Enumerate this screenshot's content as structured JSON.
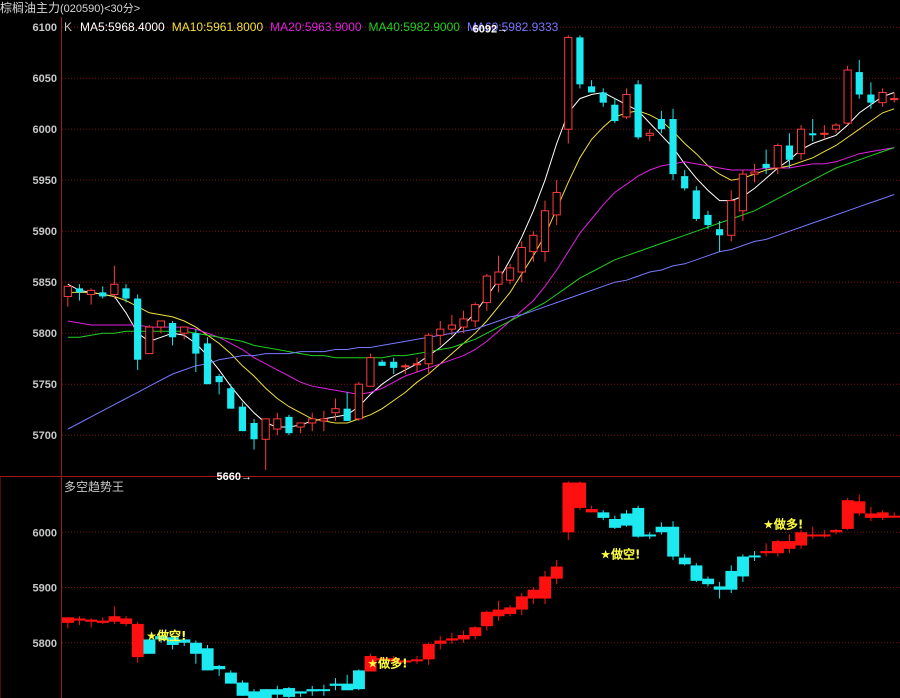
{
  "header": {
    "instrument": "棕榈油主力",
    "code": "(020590)",
    "period": "<30分>"
  },
  "colors": {
    "up": "#ff3b3b",
    "down": "#1de9f0",
    "grid": "#7a1010",
    "frame": "#a01818",
    "ma5": "#ffffff",
    "ma10": "#f0e040",
    "ma20": "#e020e0",
    "ma40": "#20d020",
    "ma60": "#7878ff",
    "signal_up_bar": "#ff1010",
    "signal_down_bar": "#1de9f0",
    "signal_text": "#ffff40"
  },
  "legend": {
    "k_label": "K",
    "items": [
      {
        "key": "ma5",
        "text": "MA5:5968.4000"
      },
      {
        "key": "ma10",
        "text": "MA10:5961.8000"
      },
      {
        "key": "ma20",
        "text": "MA20:5963.9000"
      },
      {
        "key": "ma40",
        "text": "MA40:5982.9000"
      },
      {
        "key": "ma60",
        "text": "MA60:5982.9333"
      }
    ]
  },
  "lower_panel": {
    "title": "多空趋势王"
  },
  "chart_data": [
    {
      "type": "candlestick",
      "panel": "upper",
      "title": "K",
      "ylim": [
        5660,
        6110
      ],
      "y_ticks": [
        5700,
        5750,
        5800,
        5850,
        5900,
        5950,
        6000,
        6050,
        6100
      ],
      "annotations": [
        {
          "text": "6092→",
          "bar_index": 38,
          "value": 6092
        },
        {
          "text": "5660→",
          "bar_index": 16,
          "value": 5660
        }
      ],
      "ohlc": [
        [
          5836,
          5846,
          5826,
          5846
        ],
        [
          5844,
          5848,
          5832,
          5840
        ],
        [
          5838,
          5844,
          5828,
          5842
        ],
        [
          5840,
          5846,
          5834,
          5836
        ],
        [
          5838,
          5866,
          5834,
          5848
        ],
        [
          5844,
          5848,
          5830,
          5834
        ],
        [
          5834,
          5838,
          5764,
          5774
        ],
        [
          5780,
          5808,
          5780,
          5806
        ],
        [
          5806,
          5812,
          5800,
          5812
        ],
        [
          5810,
          5812,
          5788,
          5796
        ],
        [
          5800,
          5806,
          5794,
          5806
        ],
        [
          5800,
          5804,
          5762,
          5780
        ],
        [
          5790,
          5796,
          5750,
          5750
        ],
        [
          5758,
          5760,
          5740,
          5752
        ],
        [
          5746,
          5750,
          5726,
          5726
        ],
        [
          5728,
          5732,
          5704,
          5704
        ],
        [
          5712,
          5716,
          5686,
          5696
        ],
        [
          5696,
          5716,
          5666,
          5716
        ],
        [
          5706,
          5722,
          5700,
          5716
        ],
        [
          5718,
          5720,
          5700,
          5702
        ],
        [
          5708,
          5712,
          5702,
          5712
        ],
        [
          5712,
          5722,
          5704,
          5716
        ],
        [
          5714,
          5724,
          5704,
          5716
        ],
        [
          5722,
          5736,
          5714,
          5726
        ],
        [
          5726,
          5742,
          5714,
          5714
        ],
        [
          5716,
          5752,
          5714,
          5750
        ],
        [
          5748,
          5780,
          5748,
          5776
        ],
        [
          5772,
          5774,
          5768,
          5768
        ],
        [
          5772,
          5776,
          5760,
          5766
        ],
        [
          5768,
          5770,
          5760,
          5768
        ],
        [
          5770,
          5776,
          5762,
          5770
        ],
        [
          5770,
          5800,
          5760,
          5798
        ],
        [
          5798,
          5812,
          5788,
          5804
        ],
        [
          5804,
          5818,
          5798,
          5808
        ],
        [
          5806,
          5822,
          5800,
          5814
        ],
        [
          5812,
          5830,
          5806,
          5828
        ],
        [
          5830,
          5858,
          5822,
          5856
        ],
        [
          5848,
          5876,
          5840,
          5860
        ],
        [
          5852,
          5868,
          5848,
          5864
        ],
        [
          5860,
          5890,
          5850,
          5884
        ],
        [
          5880,
          5900,
          5870,
          5896
        ],
        [
          5880,
          5930,
          5870,
          5920
        ],
        [
          5916,
          5950,
          5906,
          5938
        ],
        [
          6000,
          6092,
          5986,
          6090
        ],
        [
          6090,
          6092,
          6040,
          6044
        ],
        [
          6042,
          6048,
          6036,
          6036
        ],
        [
          6036,
          6040,
          6022,
          6026
        ],
        [
          6024,
          6030,
          6006,
          6008
        ],
        [
          6012,
          6040,
          6010,
          6034
        ],
        [
          6044,
          6048,
          5990,
          5992
        ],
        [
          5994,
          6000,
          5988,
          5996
        ],
        [
          6010,
          6018,
          5996,
          6000
        ],
        [
          6010,
          6020,
          5950,
          5956
        ],
        [
          5954,
          5960,
          5940,
          5942
        ],
        [
          5940,
          5944,
          5910,
          5912
        ],
        [
          5916,
          5920,
          5902,
          5906
        ],
        [
          5902,
          5910,
          5880,
          5896
        ],
        [
          5896,
          5940,
          5890,
          5930
        ],
        [
          5920,
          5960,
          5910,
          5956
        ],
        [
          5956,
          5966,
          5948,
          5958
        ],
        [
          5966,
          5980,
          5956,
          5962
        ],
        [
          5962,
          5986,
          5956,
          5984
        ],
        [
          5984,
          5996,
          5962,
          5970
        ],
        [
          5976,
          6004,
          5970,
          6000
        ],
        [
          5996,
          6010,
          5988,
          5994
        ],
        [
          5996,
          6004,
          5990,
          5996
        ],
        [
          6000,
          6006,
          5996,
          6004
        ],
        [
          6006,
          6062,
          6004,
          6058
        ],
        [
          6056,
          6068,
          6030,
          6034
        ],
        [
          6034,
          6046,
          6020,
          6026
        ],
        [
          6026,
          6040,
          6022,
          6036
        ],
        [
          6030,
          6036,
          6026,
          6030
        ]
      ],
      "series": [
        {
          "name": "MA5",
          "values": [
            5848,
            5842,
            5840,
            5838,
            5836,
            5820,
            5800,
            5792,
            5796,
            5800,
            5798,
            5790,
            5778,
            5764,
            5748,
            5734,
            5722,
            5712,
            5708,
            5708,
            5710,
            5714,
            5716,
            5718,
            5720,
            5728,
            5740,
            5750,
            5758,
            5764,
            5770,
            5778,
            5786,
            5796,
            5808,
            5820,
            5836,
            5852,
            5872,
            5894,
            5920,
            5950,
            5986,
            6016,
            6030,
            6034,
            6036,
            6030,
            6024,
            6018,
            6006,
            5994,
            5982,
            5966,
            5952,
            5940,
            5930,
            5930,
            5934,
            5942,
            5952,
            5962,
            5970,
            5980,
            5986,
            5990,
            5994,
            6004,
            6016,
            6024,
            6032,
            6036
          ]
        },
        {
          "name": "MA10",
          "values": [
            5840,
            5840,
            5840,
            5838,
            5836,
            5832,
            5826,
            5820,
            5818,
            5816,
            5812,
            5806,
            5798,
            5790,
            5780,
            5768,
            5758,
            5746,
            5736,
            5728,
            5722,
            5716,
            5714,
            5712,
            5712,
            5716,
            5720,
            5726,
            5734,
            5742,
            5752,
            5760,
            5770,
            5780,
            5790,
            5800,
            5812,
            5826,
            5840,
            5858,
            5876,
            5896,
            5922,
            5948,
            5972,
            5990,
            6002,
            6012,
            6016,
            6018,
            6014,
            6008,
            5998,
            5986,
            5976,
            5964,
            5956,
            5950,
            5952,
            5956,
            5960,
            5962,
            5964,
            5968,
            5972,
            5978,
            5984,
            5992,
            6000,
            6008,
            6016,
            6020
          ]
        },
        {
          "name": "MA20",
          "values": [
            5812,
            5810,
            5808,
            5808,
            5808,
            5808,
            5808,
            5806,
            5806,
            5806,
            5806,
            5804,
            5800,
            5796,
            5790,
            5784,
            5776,
            5770,
            5764,
            5758,
            5752,
            5748,
            5746,
            5744,
            5742,
            5740,
            5742,
            5746,
            5752,
            5758,
            5762,
            5766,
            5770,
            5774,
            5778,
            5784,
            5792,
            5802,
            5812,
            5822,
            5832,
            5846,
            5862,
            5880,
            5898,
            5912,
            5926,
            5938,
            5946,
            5954,
            5960,
            5964,
            5966,
            5968,
            5966,
            5964,
            5962,
            5960,
            5960,
            5960,
            5962,
            5962,
            5962,
            5964,
            5966,
            5966,
            5968,
            5972,
            5976,
            5978,
            5980,
            5982
          ]
        },
        {
          "name": "MA40",
          "values": [
            5796,
            5796,
            5798,
            5800,
            5800,
            5802,
            5802,
            5802,
            5802,
            5802,
            5802,
            5800,
            5798,
            5796,
            5794,
            5792,
            5788,
            5786,
            5784,
            5782,
            5780,
            5778,
            5778,
            5776,
            5776,
            5776,
            5776,
            5776,
            5778,
            5778,
            5780,
            5782,
            5784,
            5786,
            5790,
            5794,
            5800,
            5806,
            5812,
            5818,
            5824,
            5830,
            5838,
            5846,
            5854,
            5860,
            5866,
            5872,
            5876,
            5880,
            5884,
            5888,
            5892,
            5896,
            5900,
            5904,
            5908,
            5912,
            5916,
            5920,
            5926,
            5932,
            5938,
            5944,
            5950,
            5956,
            5962,
            5966,
            5970,
            5974,
            5978,
            5982
          ]
        },
        {
          "name": "MA60",
          "values": [
            5706,
            5712,
            5718,
            5724,
            5730,
            5736,
            5742,
            5748,
            5754,
            5760,
            5764,
            5768,
            5770,
            5774,
            5776,
            5778,
            5778,
            5780,
            5780,
            5780,
            5782,
            5782,
            5782,
            5784,
            5784,
            5786,
            5786,
            5788,
            5790,
            5792,
            5794,
            5796,
            5798,
            5800,
            5802,
            5804,
            5808,
            5812,
            5816,
            5818,
            5822,
            5826,
            5830,
            5834,
            5838,
            5842,
            5846,
            5850,
            5852,
            5856,
            5860,
            5862,
            5866,
            5868,
            5872,
            5876,
            5880,
            5882,
            5886,
            5890,
            5892,
            5896,
            5900,
            5904,
            5908,
            5912,
            5916,
            5920,
            5924,
            5928,
            5932,
            5936
          ]
        }
      ]
    },
    {
      "type": "bar",
      "panel": "lower",
      "title": "多空趋势王",
      "ylim": [
        5700,
        6100
      ],
      "y_ticks": [
        5800,
        5900,
        6000
      ],
      "signals": [
        {
          "text": "★做空!",
          "bar_index": 7,
          "value": 5812,
          "side": "short"
        },
        {
          "text": "★做多!",
          "bar_index": 26,
          "value": 5762,
          "side": "long"
        },
        {
          "text": "★做空!",
          "bar_index": 46,
          "value": 5960,
          "side": "short"
        },
        {
          "text": "★做多!",
          "bar_index": 60,
          "value": 6014,
          "side": "long"
        }
      ]
    }
  ]
}
